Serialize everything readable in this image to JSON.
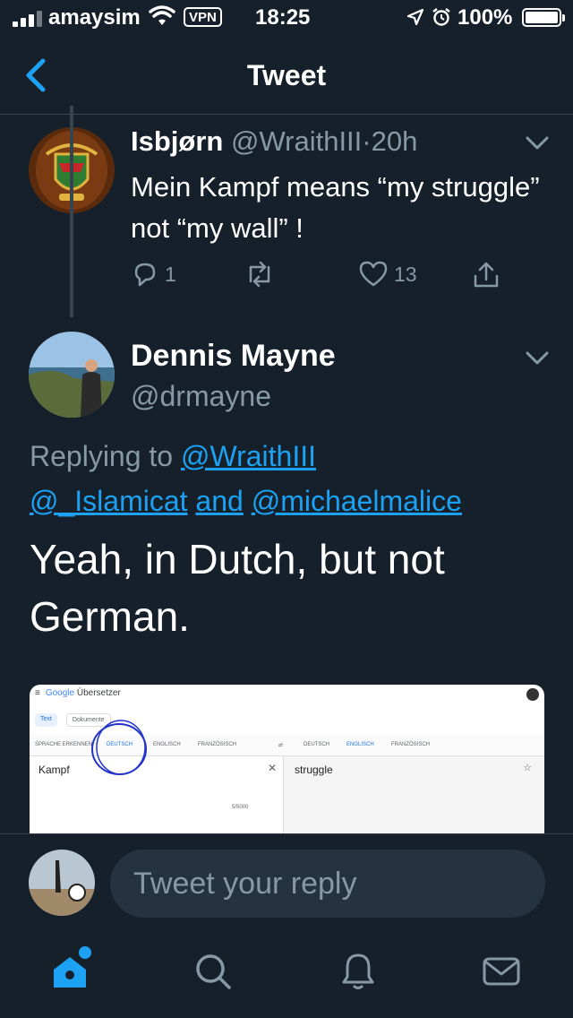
{
  "status_bar": {
    "carrier": "amaysim",
    "vpn": "VPN",
    "time": "18:25",
    "battery": "100%"
  },
  "header": {
    "title": "Tweet"
  },
  "parent_tweet": {
    "name": "Isbjørn",
    "handle": "@WraithIII",
    "separator": "·",
    "time": "20h",
    "text": "Mein Kampf means “my struggle” not “my wall” !",
    "replies": "1",
    "likes": "13",
    "avatar_icon": "military-crest-avatar"
  },
  "main_tweet": {
    "name": "Dennis Mayne",
    "handle": "@drmayne",
    "replying_prefix": "Replying to",
    "replying_to_1": "@WraithIII",
    "replying_to_2": "@_Islamicat",
    "replying_and": "and",
    "replying_to_3": "@michaelmalice",
    "text": "Yeah, in Dutch, but not German.",
    "avatar_icon": "person-on-coast-avatar"
  },
  "media": {
    "app_brand": "Google",
    "app_name": "Übersetzer",
    "tab_text": "Text",
    "tab_docs": "Dokumente",
    "src_langs": [
      "SPRACHE ERKENNEN",
      "DEUTSCH",
      "ENGLISCH",
      "FRANZÖSISCH"
    ],
    "tgt_langs": [
      "DEUTSCH",
      "ENGLISCH",
      "FRANZÖSISCH"
    ],
    "source_text": "Kampf",
    "translation": "struggle",
    "char_count": "5/5000"
  },
  "reply_bar": {
    "placeholder": "Tweet your reply"
  },
  "tab_bar": {
    "icons": [
      "home-icon",
      "search-icon",
      "notifications-icon",
      "messages-icon"
    ]
  },
  "colors": {
    "background": "#15202b",
    "accent": "#1da1f2",
    "secondary_text": "#8899a6",
    "divider": "#38444d"
  }
}
